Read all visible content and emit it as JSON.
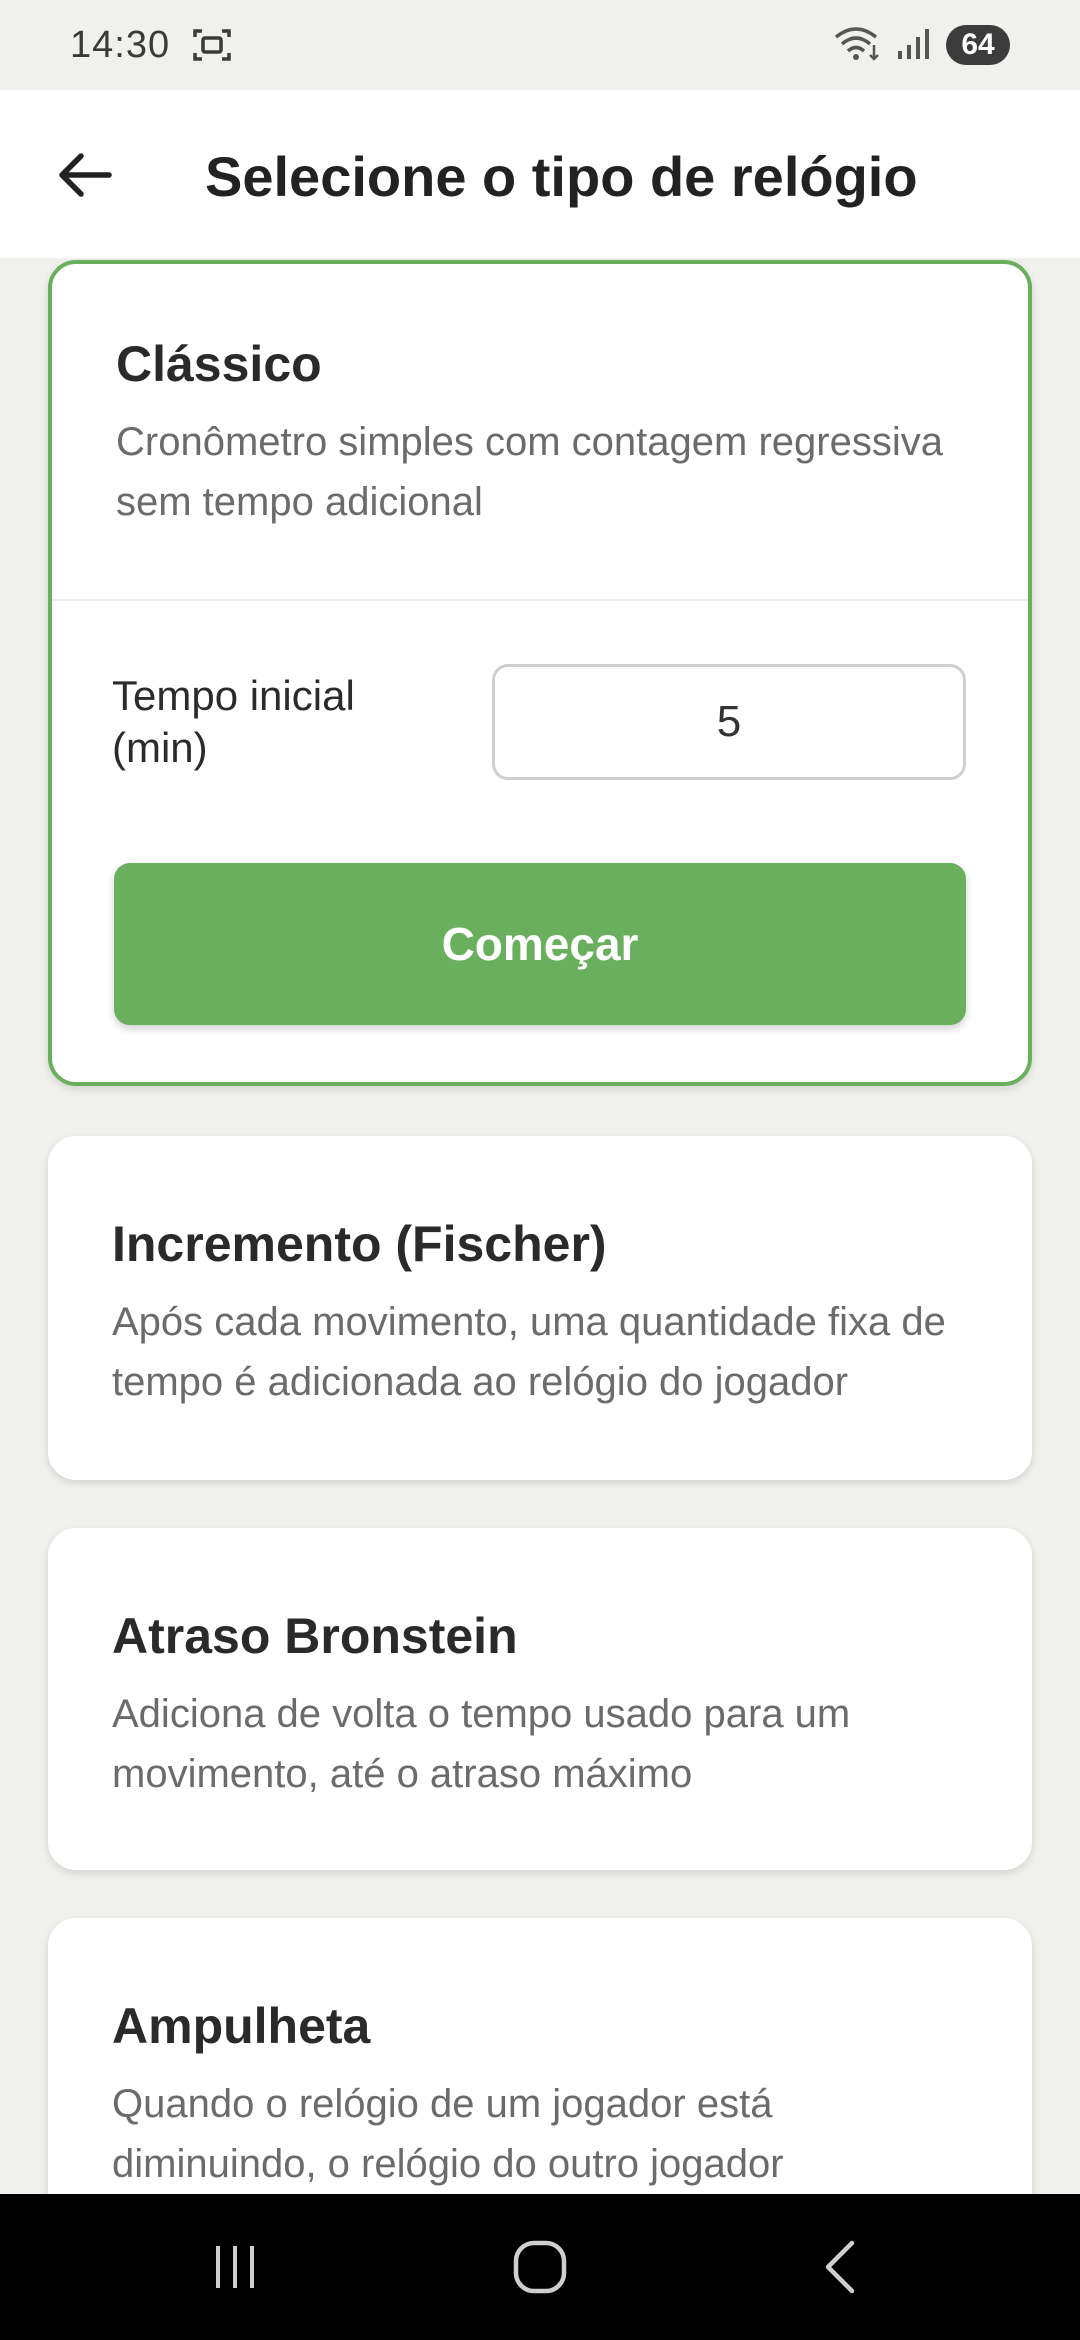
{
  "status_bar": {
    "time": "14:30",
    "battery": "64",
    "icons": [
      "screenshot-icon",
      "wifi-icon",
      "signal-icon",
      "battery-icon"
    ]
  },
  "app_bar": {
    "title": "Selecione o tipo de relógio",
    "back_icon": "arrow-left-icon"
  },
  "cards": [
    {
      "title": "Clássico",
      "description": "Cronômetro simples com contagem regressiva sem tempo adicional",
      "selected": true,
      "field_label": "Tempo inicial (min)",
      "field_value": "5",
      "button_label": "Começar"
    },
    {
      "title": "Incremento (Fischer)",
      "description": "Após cada movimento, uma quantidade fixa de tempo é adicionada ao relógio do jogador"
    },
    {
      "title": "Atraso Bronstein",
      "description": "Adiciona de volta o tempo usado para um movimento, até o atraso máximo"
    },
    {
      "title": "Ampulheta",
      "description": "Quando o relógio de um jogador está diminuindo, o relógio do outro jogador"
    }
  ],
  "nav_bar": {
    "icons": [
      "recent-apps-icon",
      "home-icon",
      "back-icon"
    ]
  },
  "colors": {
    "accent": "#6aaf5e",
    "background": "#f0f0ec",
    "nav_bar": "#000000"
  }
}
